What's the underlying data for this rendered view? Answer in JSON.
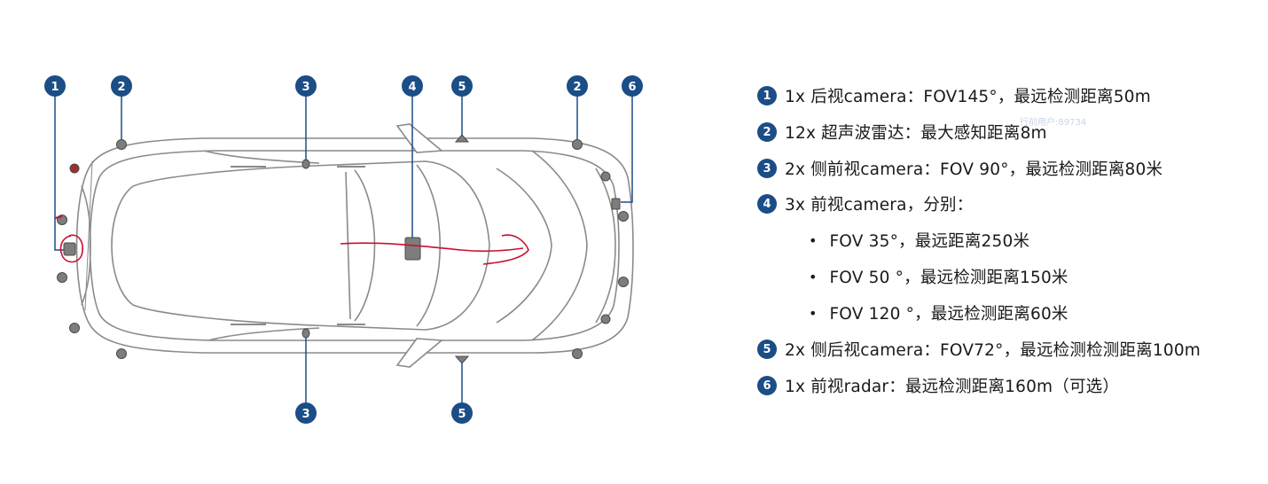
{
  "callouts": {
    "c1": "1",
    "c2a": "2",
    "c3a": "3",
    "c4": "4",
    "c5a": "5",
    "c2b": "2",
    "c6": "6",
    "c3b": "3",
    "c5b": "5"
  },
  "legend": {
    "items": [
      {
        "num": "1",
        "text": "1x 后视camera：FOV145°，最远检测距离50m"
      },
      {
        "num": "2",
        "text": "12x 超声波雷达：最大感知距离8m"
      },
      {
        "num": "3",
        "text": "2x 侧前视camera：FOV 90°，最远检测距离80米"
      },
      {
        "num": "4",
        "text": "3x 前视camera，分别："
      },
      {
        "num": "5",
        "text": "2x 侧后视camera：FOV72°，最远检测检测距离100m"
      },
      {
        "num": "6",
        "text": "1x 前视radar：最远检测距离160m（可选）"
      }
    ],
    "sub_items": [
      {
        "bullet": "•",
        "text": "FOV 35°，最远距离250米"
      },
      {
        "bullet": "•",
        "text": "FOV 50 °，最远检测距离150米"
      },
      {
        "bullet": "•",
        "text": "FOV 120 °，最远检测距离60米"
      }
    ]
  },
  "watermark": "行前用户:89734",
  "colors": {
    "badge": "#1b4d86",
    "car_outline": "#8a8a8a",
    "sensor": "#7d7d7d",
    "annotation": "#c8102e"
  }
}
